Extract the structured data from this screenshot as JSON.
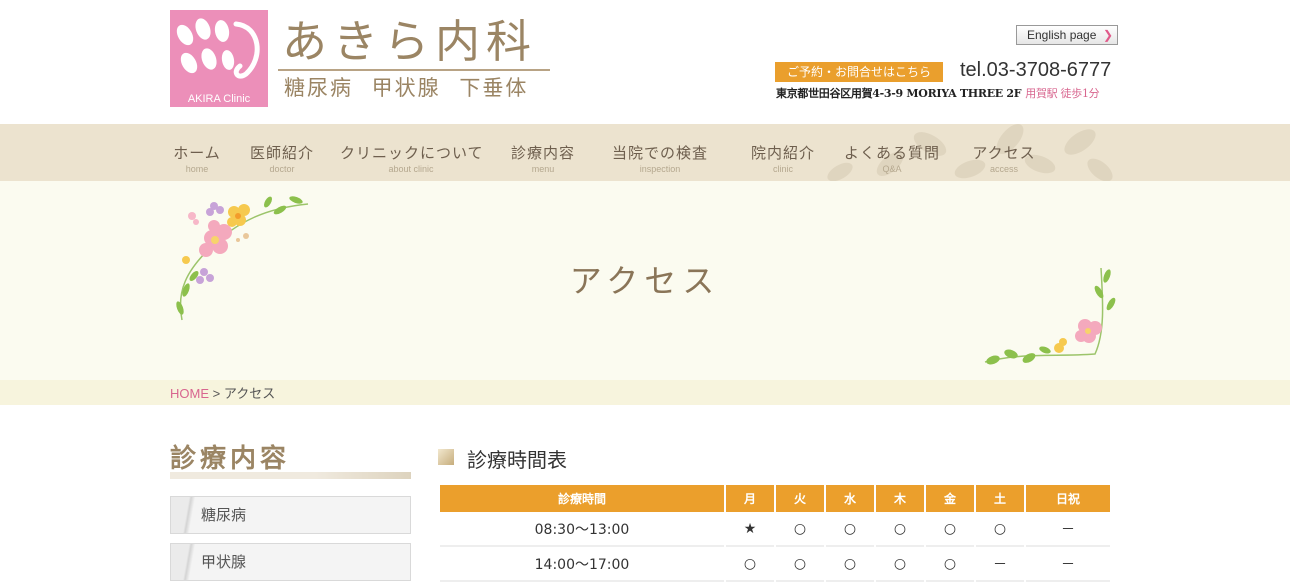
{
  "header": {
    "logo_text": "AKIRA Clinic",
    "clinic_name": "あきら内科",
    "specialties": "糖尿病 甲状腺 下垂体",
    "english_link": "English page",
    "reserve_button": "ご予約・お問合せはこちら",
    "tel": "tel.03-3708-6777",
    "address": "東京都世田谷区用賀4-3-9 MORIYA THREE 2F",
    "station": "用賀駅 徒歩1分"
  },
  "nav": [
    {
      "jp": "ホーム",
      "en": "home"
    },
    {
      "jp": "医師紹介",
      "en": "doctor"
    },
    {
      "jp": "クリニックについて",
      "en": "about clinic"
    },
    {
      "jp": "診療内容",
      "en": "menu"
    },
    {
      "jp": "当院での検査",
      "en": "inspection"
    },
    {
      "jp": "院内紹介",
      "en": "clinic"
    },
    {
      "jp": "よくある質問",
      "en": "Q&A"
    },
    {
      "jp": "アクセス",
      "en": "access"
    }
  ],
  "hero": {
    "title": "アクセス"
  },
  "breadcrumb": {
    "home": "HOME",
    "separator": ">",
    "current": "アクセス"
  },
  "sidebar": {
    "title": "診療内容",
    "items": [
      "糖尿病",
      "甲状腺"
    ]
  },
  "schedule": {
    "title": "診療時間表",
    "headers": [
      "診療時間",
      "月",
      "火",
      "水",
      "木",
      "金",
      "土",
      "日祝"
    ],
    "rows": [
      [
        "08:30〜13:00",
        "★",
        "○",
        "○",
        "○",
        "○",
        "○",
        "－"
      ],
      [
        "14:00〜17:00",
        "○",
        "○",
        "○",
        "○",
        "○",
        "－",
        "－"
      ]
    ]
  },
  "colors": {
    "accent_orange": "#eb9f2c",
    "logo_pink": "#ec8fb9",
    "nav_bg": "#ece3cf",
    "brand_brown": "#9b8564",
    "link_pink": "#d8668f"
  }
}
